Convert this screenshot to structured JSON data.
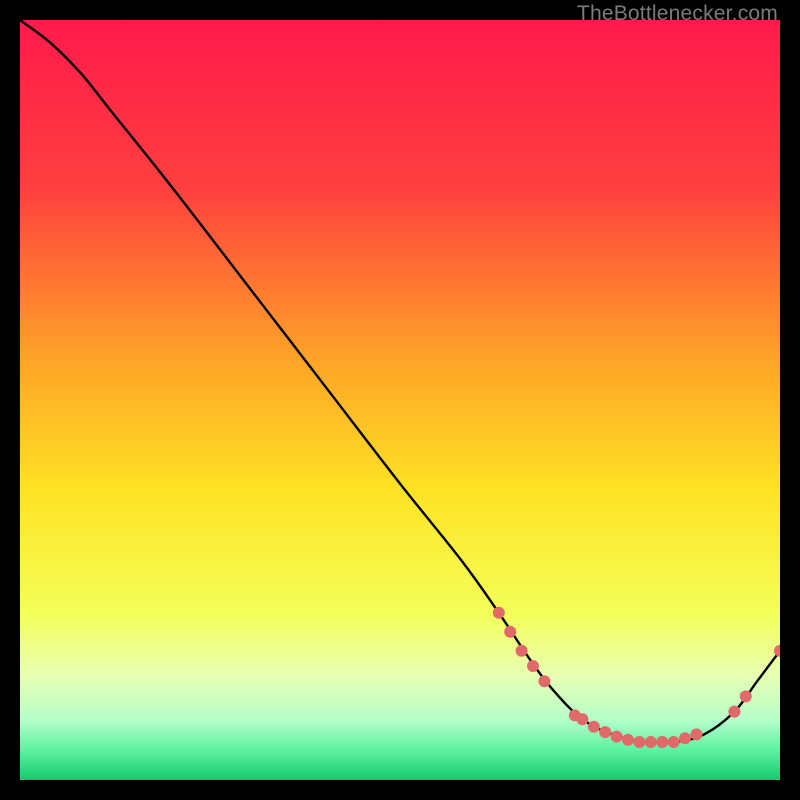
{
  "watermark": "TheBottlenecker.com",
  "chart_data": {
    "type": "line",
    "title": "",
    "xlabel": "",
    "ylabel": "",
    "xlim": [
      0,
      100
    ],
    "ylim": [
      0,
      100
    ],
    "gradient_stops": [
      {
        "offset": 0,
        "color": "#ff1a4b"
      },
      {
        "offset": 0.22,
        "color": "#ff3f3f"
      },
      {
        "offset": 0.45,
        "color": "#ffa527"
      },
      {
        "offset": 0.62,
        "color": "#ffe324"
      },
      {
        "offset": 0.78,
        "color": "#f4ff58"
      },
      {
        "offset": 0.86,
        "color": "#e8ffb0"
      },
      {
        "offset": 0.92,
        "color": "#b6ffca"
      },
      {
        "offset": 0.96,
        "color": "#5ef2a2"
      },
      {
        "offset": 1.0,
        "color": "#18c96f"
      }
    ],
    "series": [
      {
        "name": "bottleneck-curve",
        "x": [
          0,
          4,
          8,
          12,
          20,
          30,
          40,
          50,
          58,
          63,
          67,
          70,
          74,
          78,
          82,
          86,
          90,
          94,
          97,
          100
        ],
        "y": [
          100,
          97,
          93,
          88,
          78,
          65,
          52,
          39,
          29,
          22,
          16,
          12,
          8,
          6,
          5,
          5,
          6,
          9,
          13,
          17
        ]
      }
    ],
    "markers": {
      "name": "highlight-points",
      "color": "#e06a6a",
      "radius": 6,
      "points": [
        {
          "x": 63,
          "y": 22
        },
        {
          "x": 64.5,
          "y": 19.5
        },
        {
          "x": 66,
          "y": 17
        },
        {
          "x": 67.5,
          "y": 15
        },
        {
          "x": 69,
          "y": 13
        },
        {
          "x": 73,
          "y": 8.5
        },
        {
          "x": 74,
          "y": 8
        },
        {
          "x": 75.5,
          "y": 7
        },
        {
          "x": 77,
          "y": 6.3
        },
        {
          "x": 78.5,
          "y": 5.7
        },
        {
          "x": 80,
          "y": 5.3
        },
        {
          "x": 81.5,
          "y": 5
        },
        {
          "x": 83,
          "y": 5
        },
        {
          "x": 84.5,
          "y": 5
        },
        {
          "x": 86,
          "y": 5
        },
        {
          "x": 87.5,
          "y": 5.5
        },
        {
          "x": 89,
          "y": 6
        },
        {
          "x": 94,
          "y": 9
        },
        {
          "x": 95.5,
          "y": 11
        },
        {
          "x": 100,
          "y": 17
        }
      ]
    }
  }
}
